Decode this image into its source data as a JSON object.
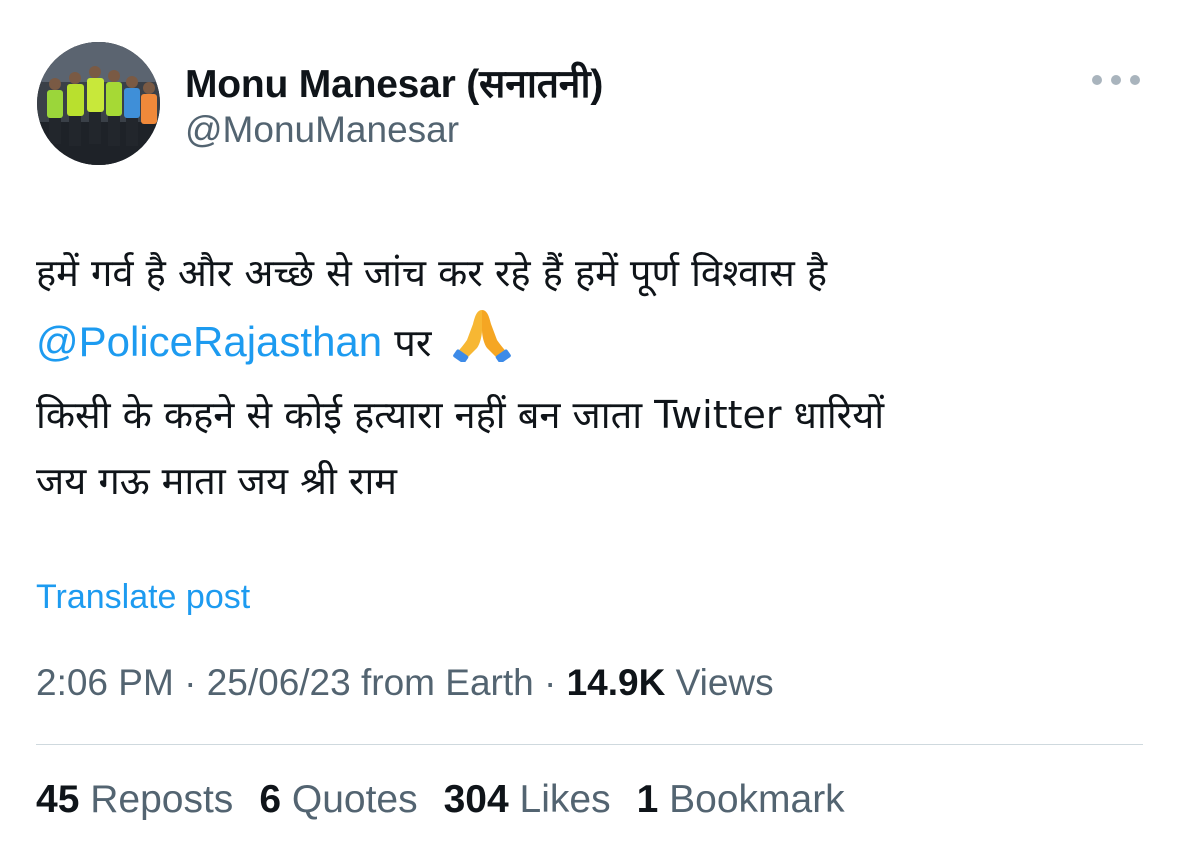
{
  "author": {
    "display_name": "Monu Manesar (सनातनी)",
    "handle": "@MonuManesar"
  },
  "post": {
    "line1": "हमें गर्व है और अच्छे से जांच कर रहे हैं हमें पूर्ण विश्वास है",
    "mention": "@PoliceRajasthan",
    "line2_suffix": "पर",
    "line3": " किसी के कहने से कोई हत्यारा नहीं बन जाता  Twitter धारियों",
    "line4": "जय गऊ माता जय  श्री राम"
  },
  "translate_label": "Translate post",
  "meta": {
    "time": "2:06 PM",
    "date": "25/06/23",
    "source": "from Earth",
    "separator": "·",
    "views_count": "14.9K",
    "views_label": "Views"
  },
  "stats": [
    {
      "count": "45",
      "label": "Reposts"
    },
    {
      "count": "6",
      "label": "Quotes"
    },
    {
      "count": "304",
      "label": "Likes"
    },
    {
      "count": "1",
      "label": "Bookmark"
    }
  ],
  "colors": {
    "link": "#1d9bf0",
    "secondary_text": "#536471",
    "primary_text": "#0f1419",
    "divider": "#cfd9de"
  },
  "icons": {
    "more": "more-dots-icon",
    "emoji": "folded-hands-emoji"
  }
}
